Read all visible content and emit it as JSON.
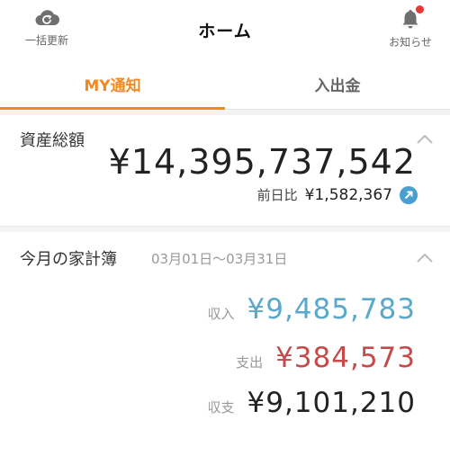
{
  "header": {
    "refresh_label": "一括更新",
    "title": "ホーム",
    "notifications_label": "お知らせ",
    "notification_dot_color": "#e53935"
  },
  "tabs": [
    {
      "label": "MY通知",
      "active": true
    },
    {
      "label": "入出金",
      "active": false
    }
  ],
  "assets": {
    "title": "資産総額",
    "total": "¥14,395,737,542",
    "prev_day_label": "前日比",
    "prev_day_value": "¥1,582,367",
    "trend": "up"
  },
  "budget": {
    "title": "今月の家計簿",
    "period": "03月01日〜03月31日",
    "income_label": "収入",
    "income_value": "¥9,485,783",
    "expense_label": "支出",
    "expense_value": "¥384,573",
    "balance_label": "収支",
    "balance_value": "¥9,101,210"
  },
  "colors": {
    "accent": "#ef8a22",
    "income": "#5aa8cc",
    "expense": "#c64a4a",
    "trend_icon": "#4a9fd0"
  },
  "icons": [
    "cloud-refresh-icon",
    "bell-icon",
    "arrow-up-right-icon",
    "chevron-up-icon"
  ]
}
